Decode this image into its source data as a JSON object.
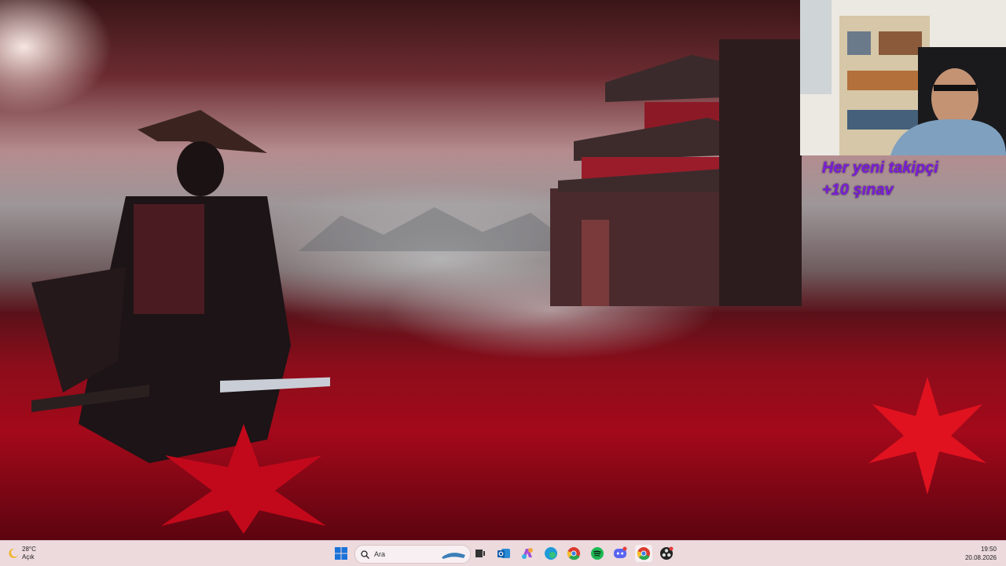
{
  "overlay": {
    "line1": "Her yeni takipçi",
    "line2": "+10 şınav"
  },
  "taskbar": {
    "weather": {
      "temperature": "28°C",
      "condition": "Açık",
      "icon": "moon-icon"
    },
    "start_icon": "windows-start-icon",
    "search": {
      "placeholder": "Ara"
    },
    "apps": [
      "task-view-icon",
      "outlook-icon",
      "copilot-icon",
      "edge-icon",
      "chrome-icon",
      "spotify-icon",
      "discord-icon",
      "chrome-active-icon",
      "obs-icon"
    ],
    "clock": {
      "time": "19:50",
      "date": "20.08.2026"
    }
  },
  "colors": {
    "overlay_text": "#7a1fd8",
    "taskbar_bg": "#ecdadd",
    "wallpaper_red": "#a3091a"
  }
}
